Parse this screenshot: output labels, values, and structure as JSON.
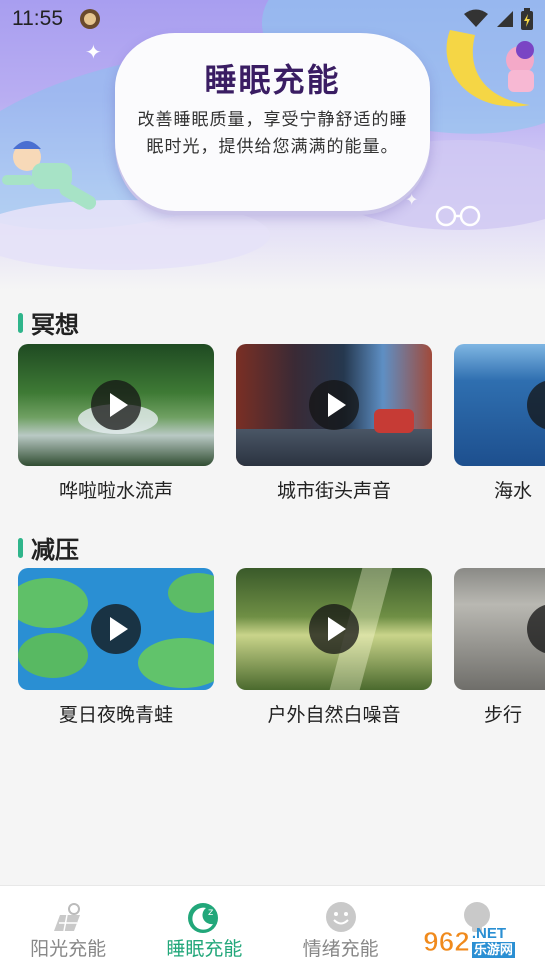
{
  "status": {
    "time": "11:55"
  },
  "hero": {
    "title": "睡眠充能",
    "description": "改善睡眠质量，享受宁静舒适的睡眠时光，提供给您满满的能量。"
  },
  "sections": [
    {
      "title": "冥想",
      "items": [
        {
          "label": "哗啦啦水流声",
          "image": "waterfall-forest"
        },
        {
          "label": "城市街头声音",
          "image": "city-street"
        },
        {
          "label": "海水",
          "image": "ocean"
        }
      ]
    },
    {
      "title": "减压",
      "items": [
        {
          "label": "夏日夜晚青蛙",
          "image": "lily-pond"
        },
        {
          "label": "户外自然白噪音",
          "image": "sunlit-forest"
        },
        {
          "label": "步行",
          "image": "street-pavement"
        }
      ]
    }
  ],
  "tabbar": {
    "tabs": [
      {
        "label": "阳光充能",
        "icon": "solar-panel-icon",
        "active": false
      },
      {
        "label": "睡眠充能",
        "icon": "moon-sleep-icon",
        "active": true
      },
      {
        "label": "情绪充能",
        "icon": "smiley-icon",
        "active": false
      },
      {
        "label": "",
        "icon": "bulb-icon",
        "active": false
      }
    ]
  },
  "watermark": {
    "number": "962",
    "suffix": ".NET",
    "caption": "乐游网"
  },
  "colors": {
    "accent": "#22a77a",
    "section_bar": "#2fb58b",
    "hero_top": "#a89ef0",
    "title": "#3a1d63"
  }
}
